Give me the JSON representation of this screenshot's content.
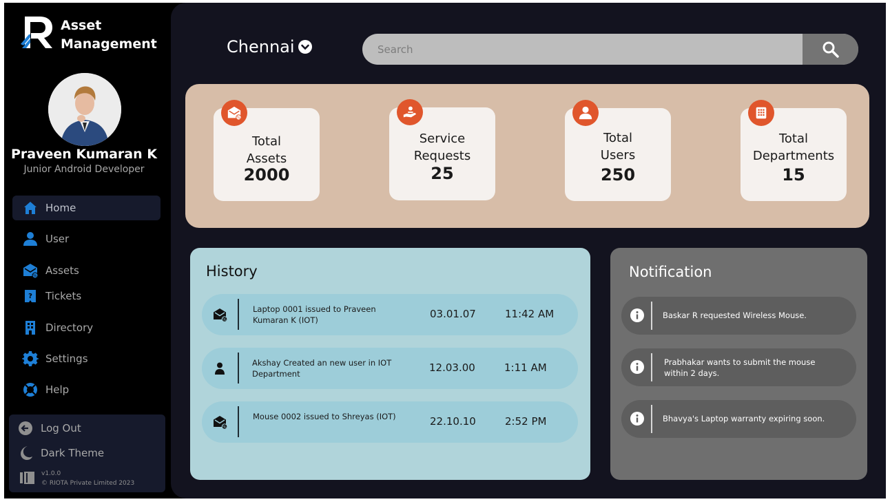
{
  "brand": {
    "line1": "Asset",
    "line2": "Management"
  },
  "profile": {
    "name": "Praveen Kumaran K",
    "role": "Junior Android Developer"
  },
  "sidebar": {
    "items": [
      {
        "label": "Home",
        "icon": "home-icon",
        "active": true
      },
      {
        "label": "User",
        "icon": "person-icon"
      },
      {
        "label": "Assets",
        "icon": "asset-box-icon"
      },
      {
        "label": "Tickets",
        "icon": "ticket-icon"
      },
      {
        "label": "Directory",
        "icon": "directory-icon"
      },
      {
        "label": "Settings",
        "icon": "gear-icon"
      },
      {
        "label": "Help",
        "icon": "lifebuoy-icon"
      }
    ],
    "logout_label": "Log Out",
    "theme_label": "Dark Theme",
    "version": "v1.0.0",
    "copyright": "© RIOTA Private Limited 2023"
  },
  "header": {
    "city": "Chennai",
    "search_placeholder": "Search"
  },
  "stats": [
    {
      "label_line1": "Total",
      "label_line2": "Assets",
      "value": "2000",
      "icon": "asset-box-icon"
    },
    {
      "label_line1": "Service",
      "label_line2": "Requests",
      "value": "25",
      "icon": "service-hand-icon"
    },
    {
      "label_line1": "Total",
      "label_line2": "Users",
      "value": "250",
      "icon": "person-icon"
    },
    {
      "label_line1": "Total",
      "label_line2": "Departments",
      "value": "15",
      "icon": "building-icon"
    }
  ],
  "history": {
    "title": "History",
    "rows": [
      {
        "text": "Laptop 0001 issued to Praveen Kumaran K (IOT)",
        "date": "03.01.07",
        "time": "11:42 AM",
        "icon": "asset-box-icon"
      },
      {
        "text": "Akshay Created an new user in  IOT Department",
        "date": "12.03.00",
        "time": "1:11 AM",
        "icon": "person-icon"
      },
      {
        "text": "Mouse 0002 issued to Shreyas (IOT)",
        "date": "22.10.10",
        "time": "2:52 PM",
        "icon": "asset-box-icon"
      }
    ]
  },
  "notifications": {
    "title": "Notification",
    "items": [
      {
        "text": "Baskar R requested Wireless Mouse."
      },
      {
        "text": "Prabhakar wants to submit the mouse within 2 days."
      },
      {
        "text": "Bhavya's Laptop warranty expiring soon."
      }
    ]
  },
  "colors": {
    "accent": "#e0562c",
    "nav_icon": "#1e7fd6",
    "stats_bg": "#d7bda8",
    "history_bg": "#b0d4da",
    "notification_bg": "#6f6f6f"
  }
}
